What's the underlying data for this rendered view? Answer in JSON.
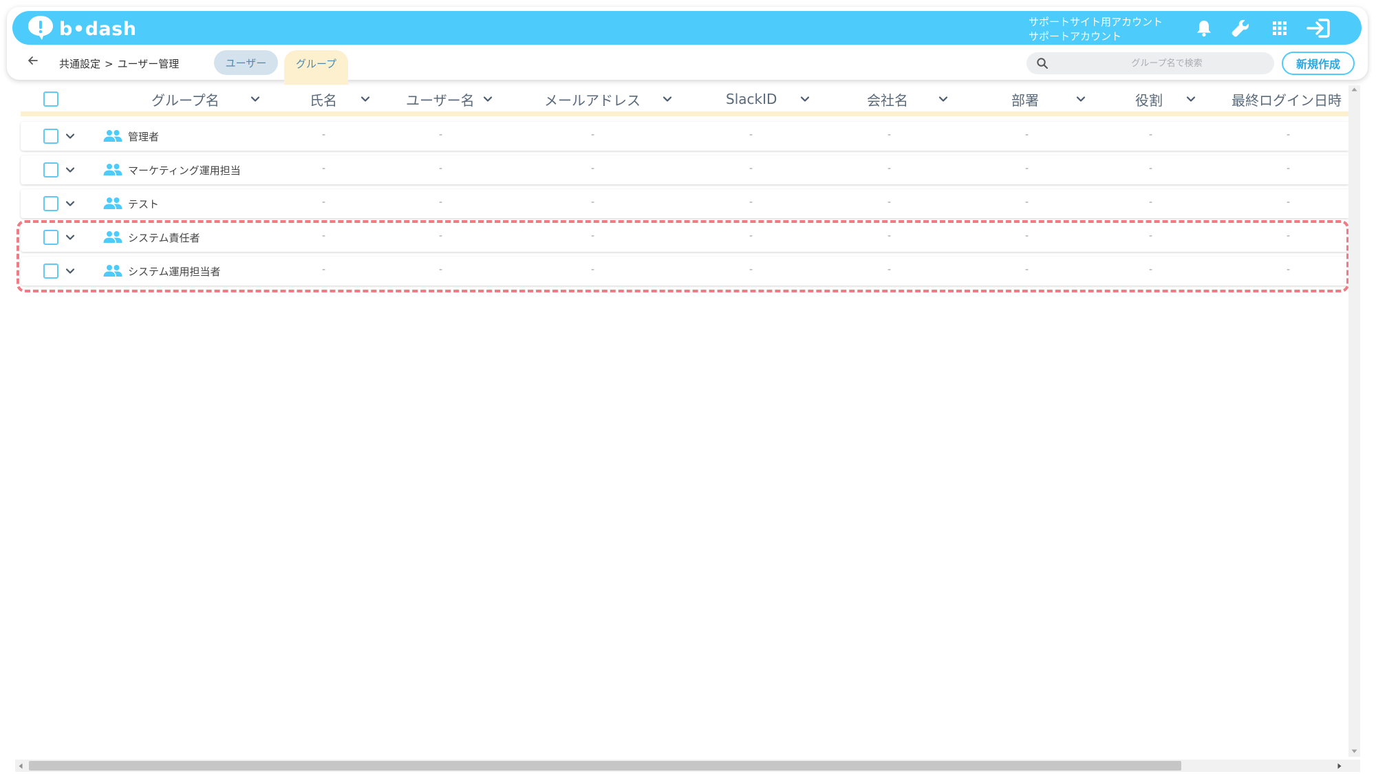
{
  "brand": {
    "name": "b•dash",
    "color": "#4dcbfa"
  },
  "account": {
    "line1": "サポートサイト用アカウント",
    "line2": "サポートアカウント"
  },
  "icons": {
    "logo": "lightbulb-bubble-icon",
    "bell": "bell-icon",
    "wrench": "wrench-icon",
    "apps": "grid-apps-icon",
    "logout": "logout-icon",
    "back": "arrow-left-icon",
    "search": "search-icon",
    "group": "people-icon"
  },
  "breadcrumb": {
    "root": "共通設定",
    "separator": ">",
    "current": "ユーザー管理"
  },
  "tabs": [
    {
      "label": "ユーザー",
      "active": false
    },
    {
      "label": "グループ",
      "active": true
    }
  ],
  "search": {
    "placeholder": "グループ名で検索",
    "value": ""
  },
  "toolbar": {
    "new_label": "新規作成"
  },
  "table": {
    "columns": [
      "グループ名",
      "氏名",
      "ユーザー名",
      "メールアドレス",
      "SlackID",
      "会社名",
      "部署",
      "役割",
      "最終ログイン日時"
    ],
    "rows": [
      {
        "name": "管理者",
        "cells": [
          "-",
          "-",
          "-",
          "-",
          "-",
          "-",
          "-",
          "-"
        ]
      },
      {
        "name": "マーケティング運用担当",
        "cells": [
          "-",
          "-",
          "-",
          "-",
          "-",
          "-",
          "-",
          "-"
        ]
      },
      {
        "name": "テスト",
        "cells": [
          "-",
          "-",
          "-",
          "-",
          "-",
          "-",
          "-",
          "-"
        ]
      },
      {
        "name": "システム責任者",
        "cells": [
          "-",
          "-",
          "-",
          "-",
          "-",
          "-",
          "-",
          "-"
        ]
      },
      {
        "name": "システム運用担当者",
        "cells": [
          "-",
          "-",
          "-",
          "-",
          "-",
          "-",
          "-",
          "-"
        ]
      }
    ]
  },
  "colors": {
    "accent": "#4dcbfa",
    "tab_active": "#fdf0cf",
    "highlight": "#f07b85",
    "checkbox": "#63c8f2"
  }
}
